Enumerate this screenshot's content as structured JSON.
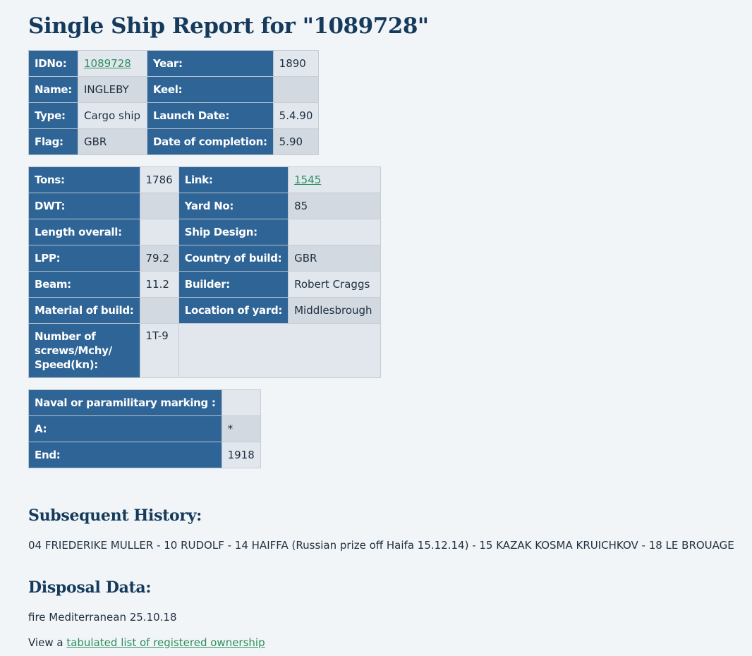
{
  "title": "Single Ship Report for \"1089728\"",
  "basic": {
    "idno_label": "IDNo:",
    "idno_value": "1089728",
    "year_label": "Year:",
    "year_value": "1890",
    "name_label": "Name:",
    "name_value": "INGLEBY",
    "keel_label": "Keel:",
    "keel_value": "",
    "type_label": "Type:",
    "type_value": "Cargo ship",
    "launch_label": "Launch Date:",
    "launch_value": "5.4.90",
    "flag_label": "Flag:",
    "flag_value": "GBR",
    "completion_label": "Date of completion:",
    "completion_value": "5.90"
  },
  "specs": {
    "tons_label": "Tons:",
    "tons_value": "1786",
    "link_label": "Link:",
    "link_value": "1545",
    "dwt_label": "DWT:",
    "dwt_value": "",
    "yard_label": "Yard No:",
    "yard_value": "85",
    "length_label": "Length overall:",
    "length_value": "",
    "design_label": "Ship Design:",
    "design_value": "",
    "lpp_label": "LPP:",
    "lpp_value": "79.2",
    "country_label": "Country of build:",
    "country_value": "GBR",
    "beam_label": "Beam:",
    "beam_value": "11.2",
    "builder_label": "Builder:",
    "builder_value": "Robert Craggs",
    "material_label": "Material of build:",
    "material_value": "",
    "location_label": "Location of yard:",
    "location_value": "Middlesbrough",
    "screws_label": "Number of screws/Mchy/ Speed(kn):",
    "screws_value": "1T-9"
  },
  "naval": {
    "marking_label": "Naval or paramilitary marking :",
    "marking_value": "",
    "a_label": "A:",
    "a_value": "*",
    "end_label": "End:",
    "end_value": "1918"
  },
  "history": {
    "heading": "Subsequent History:",
    "text": "04 FRIEDERIKE MULLER - 10 RUDOLF - 14 HAIFFA (Russian prize off Haifa 15.12.14) - 15 KAZAK KOSMA KRUICHKOV - 18 LE BROUAGE"
  },
  "disposal": {
    "heading": "Disposal Data:",
    "text": "fire Mediterranean 25.10.18",
    "view_prefix": "View a ",
    "view_link": "tabulated list of registered ownership"
  },
  "colors": {
    "label_bg": "#2e6496",
    "heading": "#153a5c",
    "link": "#2c8f5c",
    "page_bg": "#f1f5f8"
  }
}
